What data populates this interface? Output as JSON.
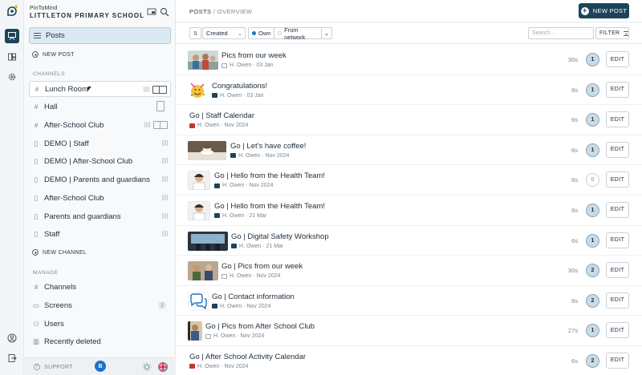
{
  "app": {
    "name": "PinToMind",
    "school": "LITTLETON PRIMARY SCHOOL"
  },
  "colors": {
    "accent": "#1d4459",
    "count_bg": "#c9dbe6",
    "own_dot": "#1a74c9",
    "version_badge": "#1a74c9"
  },
  "rail": {
    "icons": [
      "logo-icon",
      "posts-icon",
      "channels-icon",
      "settings-icon",
      "account-icon",
      "exit-icon"
    ]
  },
  "sidebar": {
    "posts_label": "Posts",
    "new_post": "NEW POST",
    "channels_title": "CHANNELS",
    "channels": [
      {
        "label": "Lunch Room",
        "prefix": "#",
        "indicator": "qr-and-landscape-screen"
      },
      {
        "label": "Hall",
        "prefix": "#",
        "indicator": "portrait-screen"
      },
      {
        "label": "After-School Club",
        "prefix": "#",
        "indicator": "qr-and-landscape-screen"
      },
      {
        "label": "DEMO | Staff",
        "prefix": "phone",
        "indicator": "qr"
      },
      {
        "label": "DEMO | After-School Club",
        "prefix": "phone",
        "indicator": "qr"
      },
      {
        "label": "DEMO | Parents and guardians",
        "prefix": "phone",
        "indicator": "qr"
      },
      {
        "label": "After-School Club",
        "prefix": "phone",
        "indicator": "qr"
      },
      {
        "label": "Parents and guardians",
        "prefix": "phone",
        "indicator": "qr"
      },
      {
        "label": "Staff",
        "prefix": "phone",
        "indicator": "qr"
      }
    ],
    "new_channel": "NEW CHANNEL",
    "manage_title": "MANAGE",
    "manage": [
      {
        "label": "Channels",
        "icon": "hash-icon"
      },
      {
        "label": "Screens",
        "icon": "screen-icon",
        "badge": "2"
      },
      {
        "label": "Users",
        "icon": "users-icon"
      },
      {
        "label": "Recently deleted",
        "icon": "trash-icon"
      }
    ],
    "footer": {
      "support": "SUPPORT",
      "version_letter": "B"
    }
  },
  "main": {
    "breadcrumb": {
      "section": "POSTS",
      "separator": "/",
      "page": "OVERVIEW"
    },
    "new_post_button": "NEW POST",
    "toolbar": {
      "sort_value": "Created",
      "filter_own": "Own",
      "filter_network": "From network",
      "search_placeholder": "Search...",
      "filter_button": "FILTER"
    },
    "posts": [
      {
        "title": "Pics from our week",
        "author": "H. Owen",
        "date": "03 Jan",
        "duration": "30s",
        "count": "1",
        "thumb": "photo-kids",
        "meta_icon": "gallery-icon"
      },
      {
        "title": "Congratulations!",
        "author": "H. Owen",
        "date": "03 Jan",
        "duration": "6s",
        "count": "1",
        "thumb": "emoji-party",
        "meta_icon": "image-icon"
      },
      {
        "title": "Go | Staff Calendar",
        "author": "H. Owen",
        "date": "Nov 2024",
        "duration": "6s",
        "count": "1",
        "thumb": "",
        "meta_icon": "calendar-icon"
      },
      {
        "title": "Go | Let's have coffee!",
        "author": "H. Owen",
        "date": "Nov 2024",
        "duration": "6s",
        "count": "1",
        "thumb": "photo-coffee",
        "meta_icon": "image-icon"
      },
      {
        "title": "Go | Hello from the Health Team!",
        "author": "H. Owen",
        "date": "Nov 2024",
        "duration": "6s",
        "count": "0",
        "thumb": "portrait-nurse",
        "meta_icon": "image-icon"
      },
      {
        "title": "Go | Hello from the Health Team!",
        "author": "H. Owen",
        "date": "21 Mar",
        "duration": "6s",
        "count": "1",
        "thumb": "portrait-nurse",
        "meta_icon": "image-icon"
      },
      {
        "title": "Go | Digital Safety Workshop",
        "author": "H. Owen",
        "date": "21 Mar",
        "duration": "6s",
        "count": "1",
        "thumb": "photo-workshop",
        "meta_icon": "image-icon"
      },
      {
        "title": "Go | Pics from our week",
        "author": "H. Owen",
        "date": "Nov 2024",
        "duration": "30s",
        "count": "2",
        "thumb": "photo-kids",
        "meta_icon": "gallery-icon"
      },
      {
        "title": "Go | Contact information",
        "author": "H. Owen",
        "date": "Nov 2024",
        "duration": "6s",
        "count": "2",
        "thumb": "chat-icon",
        "meta_icon": "image-icon"
      },
      {
        "title": "Go | Pics from After School Club",
        "author": "H. Owen",
        "date": "Nov 2024",
        "duration": "27s",
        "count": "1",
        "thumb": "photo-club",
        "meta_icon": "gallery-icon"
      },
      {
        "title": "Go | After School Activity Calendar",
        "author": "H. Owen",
        "date": "Nov 2024",
        "duration": "6s",
        "count": "2",
        "thumb": "",
        "meta_icon": "calendar-icon"
      }
    ]
  }
}
